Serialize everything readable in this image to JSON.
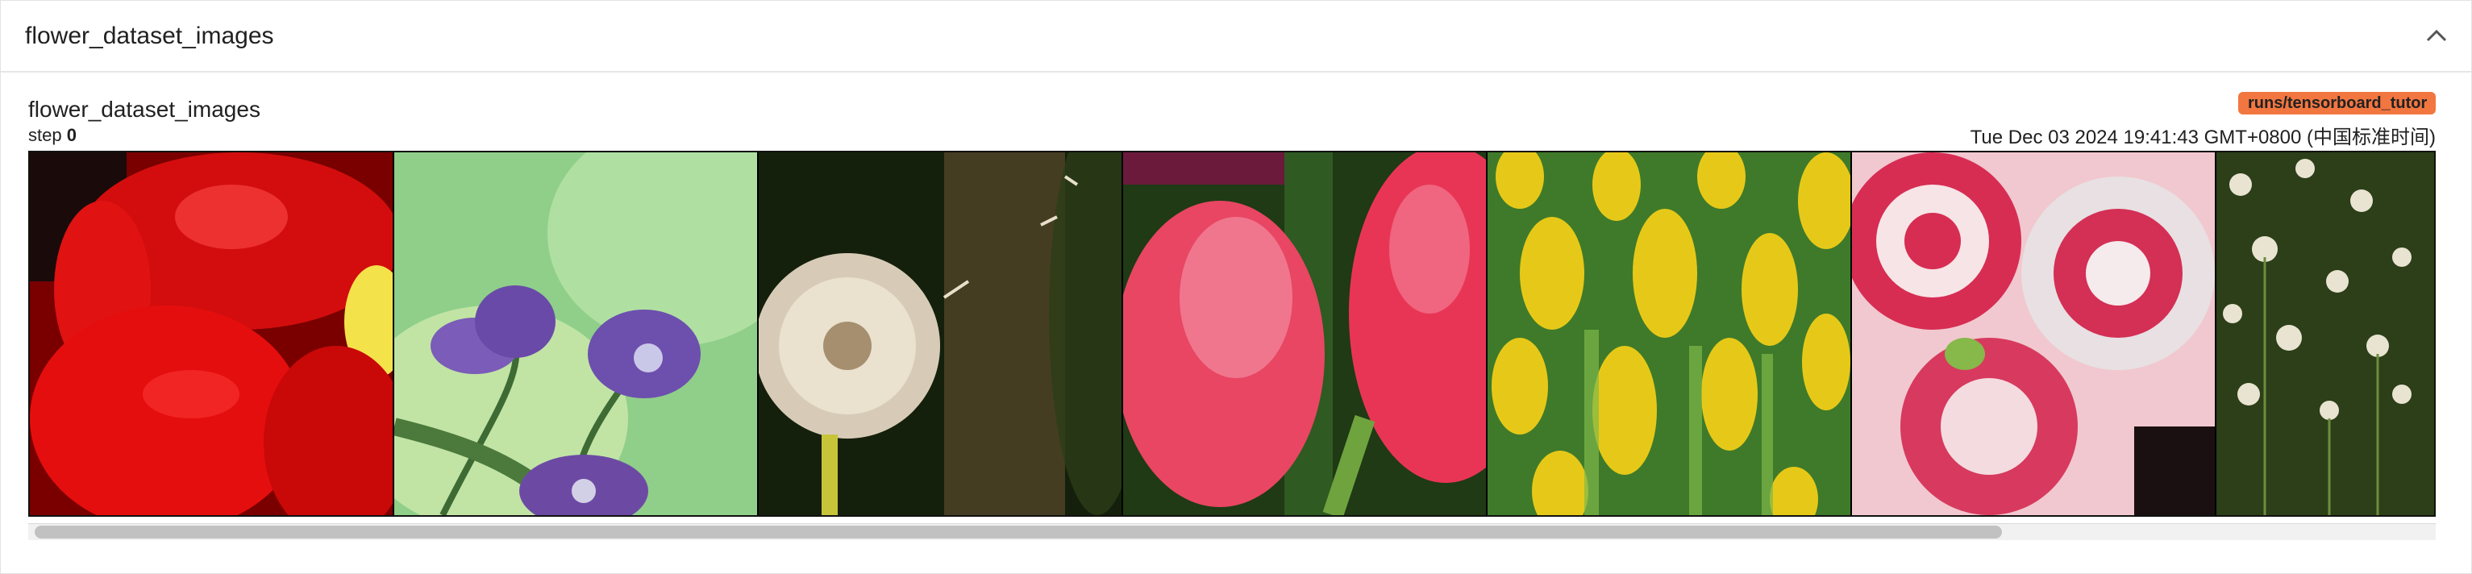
{
  "panel": {
    "title": "flower_dataset_images",
    "collapse_icon": "chevron-up-icon"
  },
  "card": {
    "tag": "flower_dataset_images",
    "step_label": "step",
    "step_value": "0",
    "run": "runs/tensorboard_tutor",
    "timestamp": "Tue Dec 03 2024 19:41:43 GMT+0800 (中国标准时间)",
    "run_badge_color": "#f27640"
  },
  "images": [
    {
      "name": "red-flower-closeup"
    },
    {
      "name": "purple-tulips-on-green"
    },
    {
      "name": "dandelion-seedhead"
    },
    {
      "name": "pink-tulips"
    },
    {
      "name": "yellow-tulips"
    },
    {
      "name": "red-white-roses"
    },
    {
      "name": "white-daisies-field"
    }
  ]
}
